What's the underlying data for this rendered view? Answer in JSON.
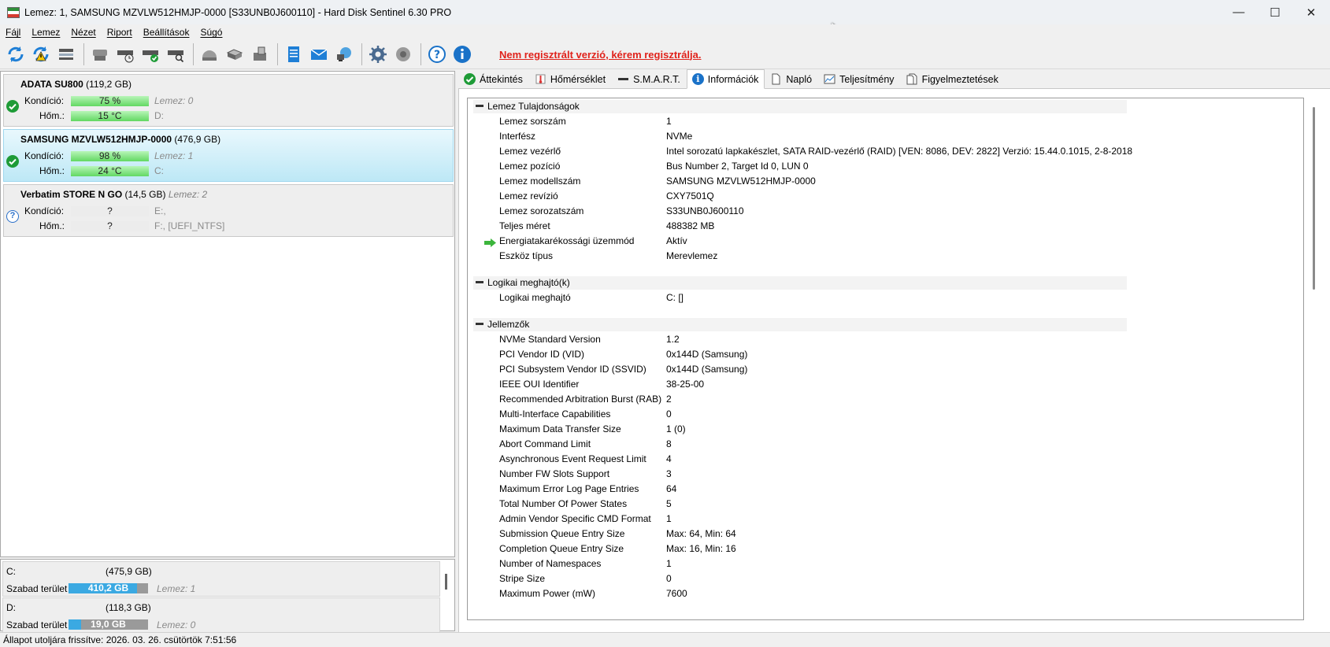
{
  "window": {
    "title": "Lemez: 1, SAMSUNG MZVLW512HMJP-0000 [S33UNB0J600110]  -  Hard Disk Sentinel 6.30 PRO",
    "minimize": "—",
    "maximize": "☐",
    "close": "✕"
  },
  "menu": [
    "Fájl",
    "Lemez",
    "Nézet",
    "Riport",
    "Beállítások",
    "Súgó"
  ],
  "toolbar": {
    "register_link": "Nem regisztrált verzió, kérem regisztrálja.",
    "icons": [
      "refresh-icon",
      "refresh-warning-icon",
      "disk-drive-icon",
      "hdd-icon",
      "hdd-clock-icon",
      "hdd-check-icon",
      "hdd-search-icon",
      "hdd-dome-icon",
      "hdd-mini-icon",
      "disk-tool-icon",
      "report-icon",
      "mail-icon",
      "network-icon",
      "settings-gear-icon",
      "sound-icon",
      "help-icon",
      "info-icon"
    ]
  },
  "disks": [
    {
      "name": "ADATA SU800",
      "size": "(119,2 GB)",
      "status": "ok",
      "kondicio_label": "Kondíció:",
      "kondicio_value": "75 %",
      "kondicio_extra": "Lemez: 0",
      "hom_label": "Hőm.:",
      "hom_value": "15 °C",
      "hom_extra": "D:"
    },
    {
      "name": "SAMSUNG MZVLW512HMJP-0000",
      "size": "(476,9 GB)",
      "status": "ok",
      "kondicio_label": "Kondíció:",
      "kondicio_value": "98 %",
      "kondicio_extra": "Lemez: 1",
      "hom_label": "Hőm.:",
      "hom_value": "24 °C",
      "hom_extra": "C:"
    },
    {
      "name": "Verbatim STORE N GO",
      "size": "(14,5 GB)",
      "disk_label": "Lemez: 2",
      "status": "unknown",
      "status_symbol": "?",
      "kondicio_label": "Kondíció:",
      "kondicio_value": "?",
      "kondicio_extra": "E:,",
      "hom_label": "Hőm.:",
      "hom_value": "?",
      "hom_extra": "F:,  [UEFI_NTFS]"
    }
  ],
  "volumes": [
    {
      "name": "C:",
      "size": "(475,9 GB)",
      "free_label": "Szabad terület",
      "free_value": "410,2 GB",
      "free_fraction": 0.86,
      "disk": "Lemez: 1"
    },
    {
      "name": "D:",
      "size": "(118,3 GB)",
      "free_label": "Szabad terület",
      "free_value": "19,0 GB",
      "free_fraction": 0.16,
      "disk": "Lemez: 0"
    }
  ],
  "tabs": [
    {
      "label": "Áttekintés",
      "icon": "check-icon"
    },
    {
      "label": "Hőmérséklet",
      "icon": "thermometer-icon"
    },
    {
      "label": "S.M.A.R.T.",
      "icon": "smart-bar-icon"
    },
    {
      "label": "Információk",
      "icon": "info-icon",
      "active": true
    },
    {
      "label": "Napló",
      "icon": "log-page-icon"
    },
    {
      "label": "Teljesítmény",
      "icon": "chart-icon"
    },
    {
      "label": "Figyelmeztetések",
      "icon": "warnings-icon"
    }
  ],
  "sections": [
    {
      "title": "Lemez Tulajdonságok",
      "rows": [
        [
          "Lemez sorszám",
          "1"
        ],
        [
          "Interfész",
          "NVMe"
        ],
        [
          "Lemez vezérlő",
          "Intel sorozatú lapkakészlet, SATA RAID-vezérlő (RAID) [VEN: 8086, DEV: 2822] Verzió: 15.44.0.1015, 2-8-2018"
        ],
        [
          "Lemez pozíció",
          "Bus Number 2, Target Id 0, LUN 0"
        ],
        [
          "Lemez modellszám",
          "SAMSUNG MZVLW512HMJP-0000"
        ],
        [
          "Lemez revízió",
          "CXY7501Q"
        ],
        [
          "Lemez sorozatszám",
          "S33UNB0J600110"
        ],
        [
          "Teljes méret",
          "488382 MB"
        ],
        [
          "Energiatakarékossági üzemmód",
          "Aktív"
        ],
        [
          "Eszköz típus",
          "Merevlemez"
        ]
      ]
    },
    {
      "title": "Logikai meghajtó(k)",
      "rows": [
        [
          "Logikai meghajtó",
          "C: []"
        ]
      ]
    },
    {
      "title": "Jellemzők",
      "rows": [
        [
          "NVMe Standard Version",
          "1.2"
        ],
        [
          "PCI Vendor ID (VID)",
          "0x144D (Samsung)"
        ],
        [
          "PCI Subsystem Vendor ID (SSVID)",
          "0x144D (Samsung)"
        ],
        [
          "IEEE OUI Identifier",
          "38-25-00"
        ],
        [
          "Recommended Arbitration Burst (RAB)",
          "2"
        ],
        [
          "Multi-Interface Capabilities",
          "0"
        ],
        [
          "Maximum Data Transfer Size",
          "1 (0)"
        ],
        [
          "Abort Command Limit",
          "8"
        ],
        [
          "Asynchronous Event Request Limit",
          "4"
        ],
        [
          "Number FW Slots Support",
          "3"
        ],
        [
          "Maximum Error Log Page Entries",
          "64"
        ],
        [
          "Total Number Of Power States",
          "5"
        ],
        [
          "Admin Vendor Specific CMD Format",
          "1"
        ],
        [
          "Submission Queue Entry Size",
          "Max: 64, Min: 64"
        ],
        [
          "Completion Queue Entry Size",
          "Max: 16, Min: 16"
        ],
        [
          "Number of Namespaces",
          "1"
        ],
        [
          "Stripe Size",
          "0"
        ],
        [
          "Maximum Power (mW)",
          "7600"
        ]
      ]
    }
  ],
  "statusbar": "Állapot utoljára frissítve: 2026. 03. 26. csütörtök 7:51:56",
  "colors": {
    "accent_blue": "#3ba9e2",
    "ok_green": "#1e9b37",
    "link_red": "#e0221b",
    "bar_green": "#62d862"
  }
}
